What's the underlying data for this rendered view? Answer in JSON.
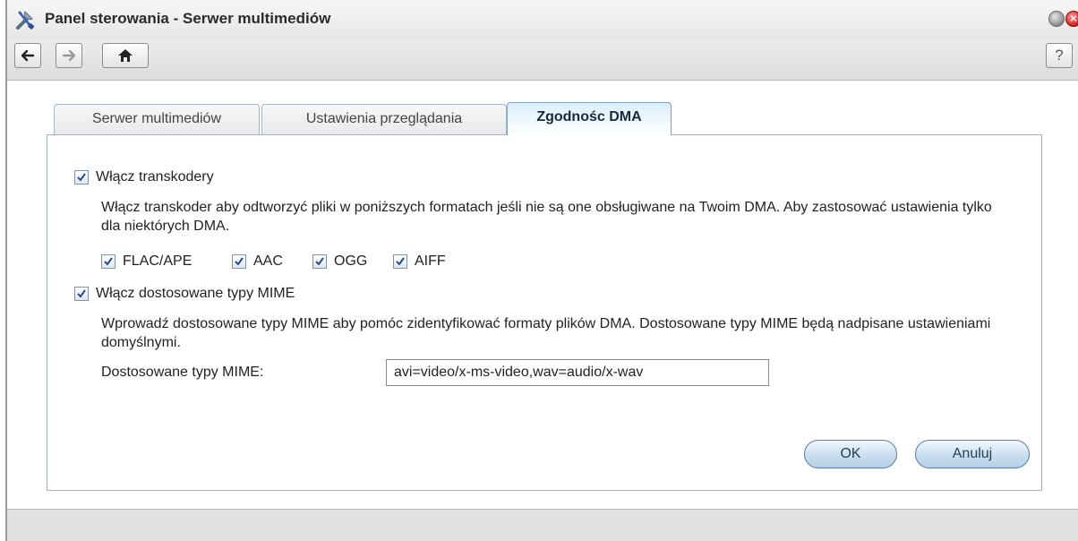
{
  "window": {
    "title": "Panel sterowania - Serwer multimediów"
  },
  "toolbar": {
    "back_icon": "arrow-left-icon",
    "forward_icon": "arrow-right-icon",
    "home_icon": "home-icon",
    "help_label": "?"
  },
  "tabs": [
    {
      "label": "Serwer multimediów",
      "active": false
    },
    {
      "label": "Ustawienia przeglądania",
      "active": false
    },
    {
      "label": "Zgodnośc DMA",
      "active": true
    }
  ],
  "transcoders": {
    "enable_label": "Włącz transkodery",
    "enabled": true,
    "description": "Włącz transkoder aby odtworzyć pliki w poniższych formatach jeśli nie są one obsługiwane na Twoim DMA. Aby zastosować ustawienia tylko dla niektórych DMA.",
    "formats": [
      {
        "label": "FLAC/APE",
        "checked": true
      },
      {
        "label": "AAC",
        "checked": true
      },
      {
        "label": "OGG",
        "checked": true
      },
      {
        "label": "AIFF",
        "checked": true
      }
    ]
  },
  "mime": {
    "enable_label": "Włącz dostosowane typy MIME",
    "enabled": true,
    "description": "Wprowadź dostosowane typy MIME aby pomóc zidentyfikować formaty plików DMA. Dostosowane typy MIME będą nadpisane ustawieniami domyślnymi.",
    "field_label": "Dostosowane typy MIME:",
    "field_value": "avi=video/x-ms-video,wav=audio/x-wav"
  },
  "buttons": {
    "ok_label": "OK",
    "cancel_label": "Anuluj"
  },
  "colors": {
    "accent": "#c9def0",
    "checkmark": "#2b4a8a",
    "close": "#d41c1c"
  }
}
